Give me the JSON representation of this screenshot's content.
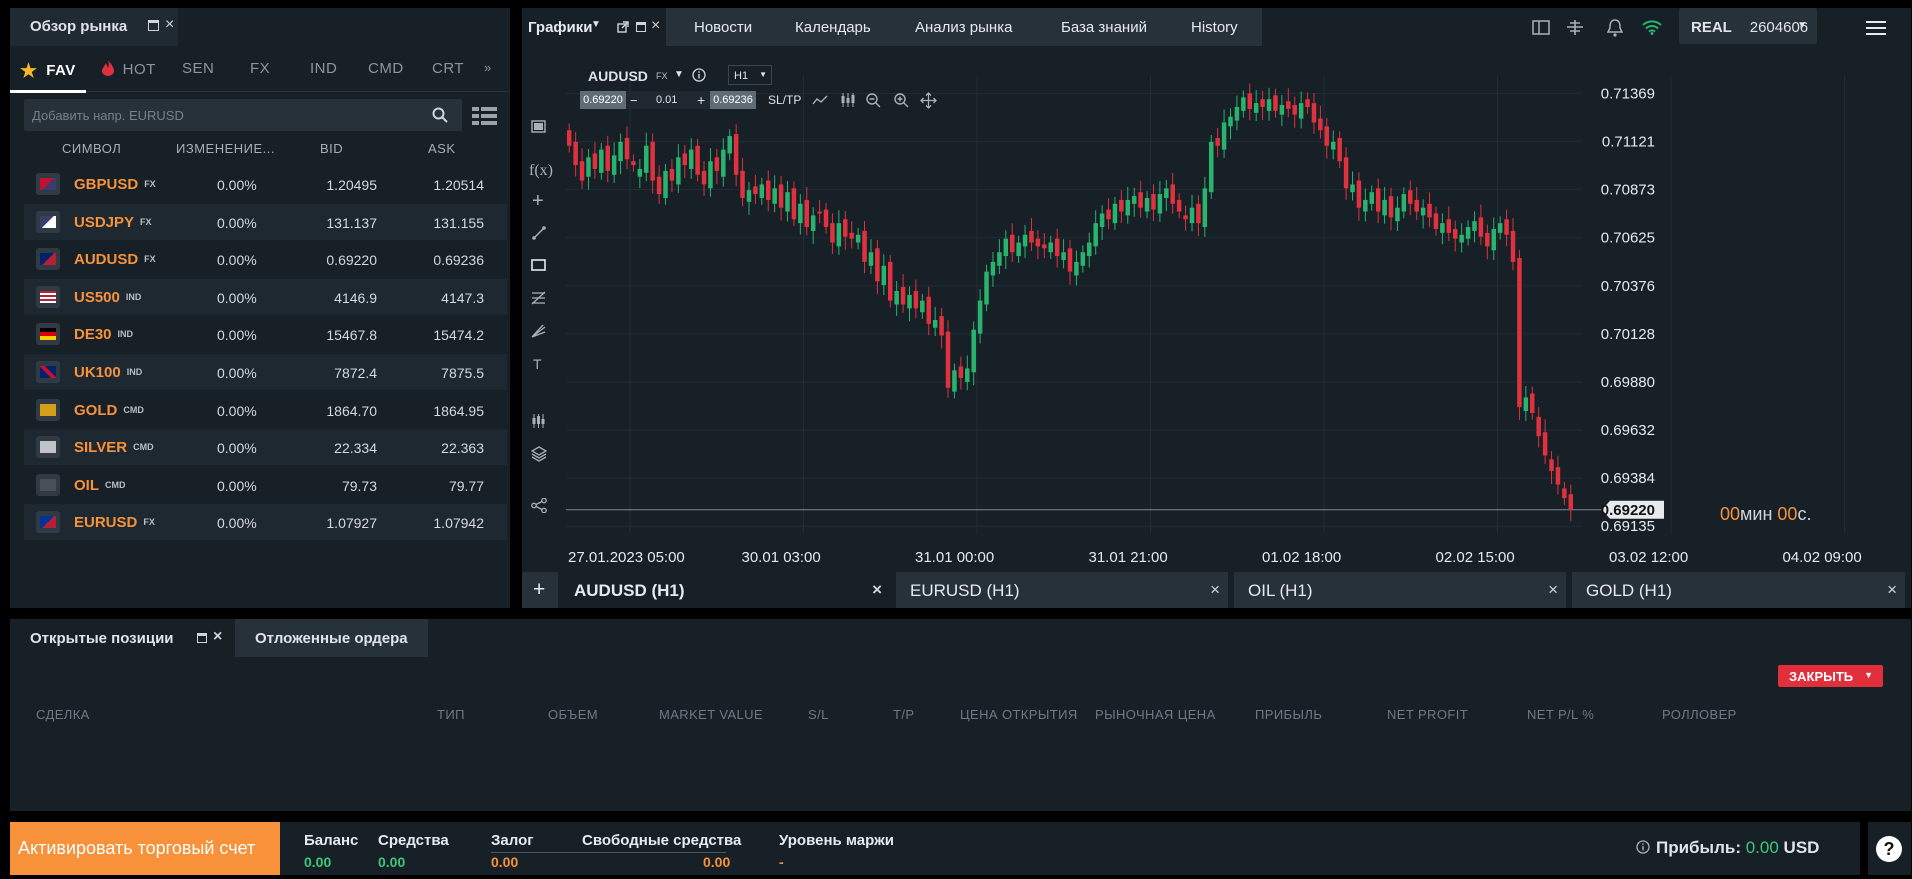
{
  "colors": {
    "accent": "#f7923a",
    "bull": "#28b46e",
    "bear": "#e0323e",
    "green_val": "#3cc87a"
  },
  "market_watch": {
    "title": "Обзор рынка",
    "categories": [
      {
        "label": "FAV",
        "icon": "star-icon",
        "active": true
      },
      {
        "label": "HOT",
        "icon": "flame-icon"
      },
      {
        "label": "SEN"
      },
      {
        "label": "FX"
      },
      {
        "label": "IND"
      },
      {
        "label": "CMD"
      },
      {
        "label": "CRT"
      }
    ],
    "search_placeholder": "Добавить напр. EURUSD",
    "columns": {
      "symbol": "СИМВОЛ",
      "change": "ИЗМЕНЕНИЕ...",
      "bid": "BID",
      "ask": "ASK"
    },
    "rows": [
      {
        "symbol": "GBPUSD",
        "type": "FX",
        "change": "0.00%",
        "bid": "1.20495",
        "ask": "1.20514",
        "flag": "gb-us"
      },
      {
        "symbol": "USDJPY",
        "type": "FX",
        "change": "0.00%",
        "bid": "131.137",
        "ask": "131.155",
        "flag": "us-jp"
      },
      {
        "symbol": "AUDUSD",
        "type": "FX",
        "change": "0.00%",
        "bid": "0.69220",
        "ask": "0.69236",
        "flag": "au-us"
      },
      {
        "symbol": "US500",
        "type": "IND",
        "change": "0.00%",
        "bid": "4146.9",
        "ask": "4147.3",
        "flag": "us"
      },
      {
        "symbol": "DE30",
        "type": "IND",
        "change": "0.00%",
        "bid": "15467.8",
        "ask": "15474.2",
        "flag": "de"
      },
      {
        "symbol": "UK100",
        "type": "IND",
        "change": "0.00%",
        "bid": "7872.4",
        "ask": "7875.5",
        "flag": "gb"
      },
      {
        "symbol": "GOLD",
        "type": "CMD",
        "change": "0.00%",
        "bid": "1864.70",
        "ask": "1864.95",
        "flag": "au"
      },
      {
        "symbol": "SILVER",
        "type": "CMD",
        "change": "0.00%",
        "bid": "22.334",
        "ask": "22.363",
        "flag": "ag"
      },
      {
        "symbol": "OIL",
        "type": "CMD",
        "change": "0.00%",
        "bid": "79.73",
        "ask": "79.77",
        "flag": "oil"
      },
      {
        "symbol": "EURUSD",
        "type": "FX",
        "change": "0.00%",
        "bid": "1.07927",
        "ask": "1.07942",
        "flag": "eu-us"
      }
    ]
  },
  "top_tabs": [
    "Графики",
    "Новости",
    "Календарь",
    "Анализ рынка",
    "База знаний",
    "History"
  ],
  "account": {
    "type": "REAL",
    "number": "2604606"
  },
  "chart": {
    "symbol": "AUDUSD",
    "symbol_type": "FX",
    "timeframe": "H1",
    "bid": "0.69220",
    "volume": "0.01",
    "ask": "0.69236",
    "sltp": "SL/TP",
    "countdown": {
      "min": "00",
      "min_label": "мин",
      "sec": "00",
      "sec_label": "с."
    },
    "current_price": "0.69220"
  },
  "chart_data": {
    "type": "candlestick",
    "y_ticks": [
      "0.71369",
      "0.71121",
      "0.70873",
      "0.70625",
      "0.70376",
      "0.70128",
      "0.69880",
      "0.69632",
      "0.69384",
      "0.69135"
    ],
    "x_ticks": [
      "27.01.2023 05:00",
      "30.01 03:00",
      "31.01 00:00",
      "31.01 21:00",
      "01.02 18:00",
      "02.02 15:00",
      "03.02 12:00",
      "04.02 09:00"
    ],
    "ylim": [
      0.691,
      0.7146
    ],
    "close": [
      0.711,
      0.71,
      0.7092,
      0.7104,
      0.7098,
      0.7108,
      0.7097,
      0.7105,
      0.7112,
      0.7103,
      0.71,
      0.7098,
      0.711,
      0.7092,
      0.7085,
      0.7097,
      0.7092,
      0.7104,
      0.71,
      0.7108,
      0.7095,
      0.709,
      0.7102,
      0.7097,
      0.7108,
      0.7115,
      0.7095,
      0.7083,
      0.7087,
      0.7085,
      0.709,
      0.7082,
      0.7088,
      0.7078,
      0.7086,
      0.7072,
      0.708,
      0.7068,
      0.7074,
      0.7075,
      0.7068,
      0.706,
      0.707,
      0.7063,
      0.7062,
      0.7064,
      0.705,
      0.7055,
      0.704,
      0.7048,
      0.703,
      0.7035,
      0.7028,
      0.7033,
      0.7026,
      0.703,
      0.7018,
      0.702,
      0.7012,
      0.6985,
      0.6994,
      0.699,
      0.6995,
      0.7015,
      0.703,
      0.7045,
      0.705,
      0.7055,
      0.7062,
      0.7055,
      0.706,
      0.7064,
      0.706,
      0.7058,
      0.7057,
      0.706,
      0.7053,
      0.7055,
      0.7045,
      0.705,
      0.7055,
      0.706,
      0.707,
      0.7075,
      0.7072,
      0.708,
      0.7076,
      0.7082,
      0.7084,
      0.7078,
      0.7083,
      0.7077,
      0.7085,
      0.7088,
      0.708,
      0.7076,
      0.7072,
      0.7078,
      0.707,
      0.7088,
      0.7112,
      0.711,
      0.7122,
      0.7125,
      0.713,
      0.7135,
      0.7129,
      0.7132,
      0.713,
      0.7134,
      0.7128,
      0.7131,
      0.7129,
      0.7126,
      0.7132,
      0.713,
      0.7122,
      0.7118,
      0.711,
      0.7112,
      0.7102,
      0.7088,
      0.709,
      0.7078,
      0.7082,
      0.7086,
      0.7076,
      0.7082,
      0.7073,
      0.7078,
      0.7085,
      0.708,
      0.7076,
      0.7078,
      0.7073,
      0.7067,
      0.707,
      0.7065,
      0.7062,
      0.7064,
      0.7068,
      0.7071,
      0.7063,
      0.7058,
      0.7067,
      0.707,
      0.7064,
      0.705,
      0.6975,
      0.698,
      0.6972,
      0.696,
      0.695,
      0.6942,
      0.6935,
      0.6928,
      0.6922
    ],
    "open": [
      0.7118,
      0.7112,
      0.7102,
      0.7094,
      0.7106,
      0.7096,
      0.711,
      0.7095,
      0.7102,
      0.7114,
      0.7102,
      0.7094,
      0.7096,
      0.7112,
      0.7094,
      0.7083,
      0.7098,
      0.709,
      0.7106,
      0.7098,
      0.711,
      0.7097,
      0.7088,
      0.7104,
      0.7094,
      0.7106,
      0.7116,
      0.7097,
      0.7081,
      0.7089,
      0.7083,
      0.7092,
      0.708,
      0.709,
      0.7076,
      0.7088,
      0.707,
      0.7082,
      0.7066,
      0.7076,
      0.7077,
      0.707,
      0.7058,
      0.7072,
      0.7065,
      0.706,
      0.7066,
      0.7048,
      0.7057,
      0.7038,
      0.705,
      0.7028,
      0.7037,
      0.7026,
      0.7035,
      0.7024,
      0.7032,
      0.7016,
      0.7022,
      0.7014,
      0.6983,
      0.6996,
      0.6988,
      0.6993,
      0.7013,
      0.7028,
      0.7043,
      0.7048,
      0.7053,
      0.7064,
      0.7053,
      0.7058,
      0.7066,
      0.7062,
      0.7059,
      0.7055,
      0.7062,
      0.7051,
      0.7057,
      0.7043,
      0.7048,
      0.7053,
      0.7058,
      0.7068,
      0.7077,
      0.707,
      0.7082,
      0.7074,
      0.708,
      0.7086,
      0.7076,
      0.7085,
      0.7075,
      0.7083,
      0.709,
      0.7082,
      0.7074,
      0.707,
      0.708,
      0.7068,
      0.7086,
      0.7114,
      0.7108,
      0.712,
      0.7123,
      0.7128,
      0.7137,
      0.7127,
      0.7134,
      0.7128,
      0.7136,
      0.7126,
      0.7133,
      0.7131,
      0.7124,
      0.7134,
      0.7132,
      0.7124,
      0.712,
      0.7108,
      0.7114,
      0.7104,
      0.7086,
      0.7092,
      0.7076,
      0.708,
      0.7088,
      0.7074,
      0.7084,
      0.7071,
      0.7076,
      0.7087,
      0.7082,
      0.7074,
      0.708,
      0.7075,
      0.7065,
      0.7072,
      0.7067,
      0.706,
      0.7062,
      0.7066,
      0.7073,
      0.7065,
      0.7056,
      0.7065,
      0.7072,
      0.7066,
      0.7052,
      0.6973,
      0.6982,
      0.697,
      0.6962,
      0.6948,
      0.6944,
      0.6933,
      0.693
    ]
  },
  "chart_tabs": [
    {
      "label": "AUDUSD (H1)",
      "active": true
    },
    {
      "label": "EURUSD (H1)"
    },
    {
      "label": "OIL (H1)"
    },
    {
      "label": "GOLD (H1)"
    }
  ],
  "positions": {
    "tabs": [
      "Открытые позиции",
      "Отложенные ордера"
    ],
    "columns": [
      "СДЕЛКА",
      "ТИП",
      "ОБЪЕМ",
      "MARKET VALUE",
      "S/L",
      "T/P",
      "ЦЕНА ОТКРЫТИЯ",
      "РЫНОЧНАЯ ЦЕНА",
      "ПРИБЫЛЬ",
      "NET PROFIT",
      "NET P/L %",
      "РОЛЛОВЕР"
    ],
    "close_label": "ЗАКРЫТЬ"
  },
  "footer": {
    "activate": "Активировать торговый счет",
    "balance_label": "Баланс",
    "balance": "0.00",
    "equity_label": "Средства",
    "equity": "0.00",
    "margin_label": "Залог",
    "margin": "0.00",
    "free_label": "Свободные средства",
    "free": "0.00",
    "level_label": "Уровень маржи",
    "level": "-",
    "profit_label": "Прибыль:",
    "profit": "0.00",
    "currency": "USD"
  }
}
